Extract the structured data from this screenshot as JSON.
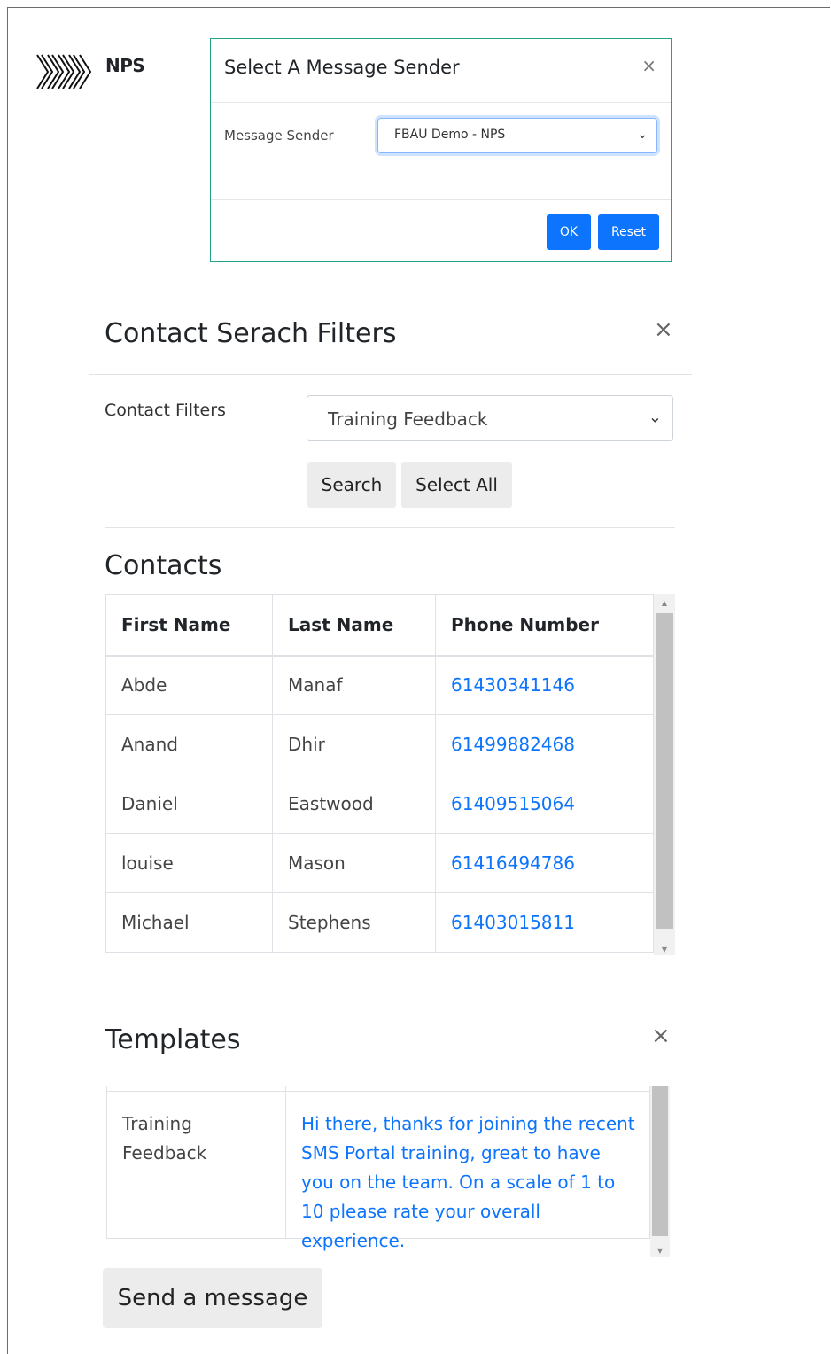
{
  "brand": {
    "name": "NPS"
  },
  "sender_modal": {
    "title": "Select A Message Sender",
    "close": "×",
    "label": "Message Sender",
    "selected": "FBAU Demo - NPS",
    "ok_label": "OK",
    "reset_label": "Reset"
  },
  "filters": {
    "title": "Contact Serach Filters",
    "close": "×",
    "label": "Contact Filters",
    "selected": "Training Feedback",
    "search_label": "Search",
    "select_all_label": "Select All"
  },
  "contacts": {
    "title": "Contacts",
    "columns": [
      "First Name",
      "Last Name",
      "Phone Number"
    ],
    "rows": [
      {
        "first": "Abde",
        "last": "Manaf",
        "phone": "61430341146"
      },
      {
        "first": "Anand",
        "last": "Dhir",
        "phone": "61499882468"
      },
      {
        "first": "Daniel",
        "last": "Eastwood",
        "phone": "61409515064"
      },
      {
        "first": "louise",
        "last": "Mason",
        "phone": "61416494786"
      },
      {
        "first": "Michael",
        "last": "Stephens",
        "phone": "61403015811"
      }
    ]
  },
  "templates": {
    "title": "Templates",
    "close": "×",
    "row": {
      "name": "Training Feedback",
      "body": "Hi there, thanks for joining the recent SMS Portal training, great to have you on the team. On a scale of 1 to 10 please rate your overall experience."
    }
  },
  "send_label": "Send a message",
  "colors": {
    "accent": "#0d74fd",
    "modal_border": "#22a387"
  }
}
